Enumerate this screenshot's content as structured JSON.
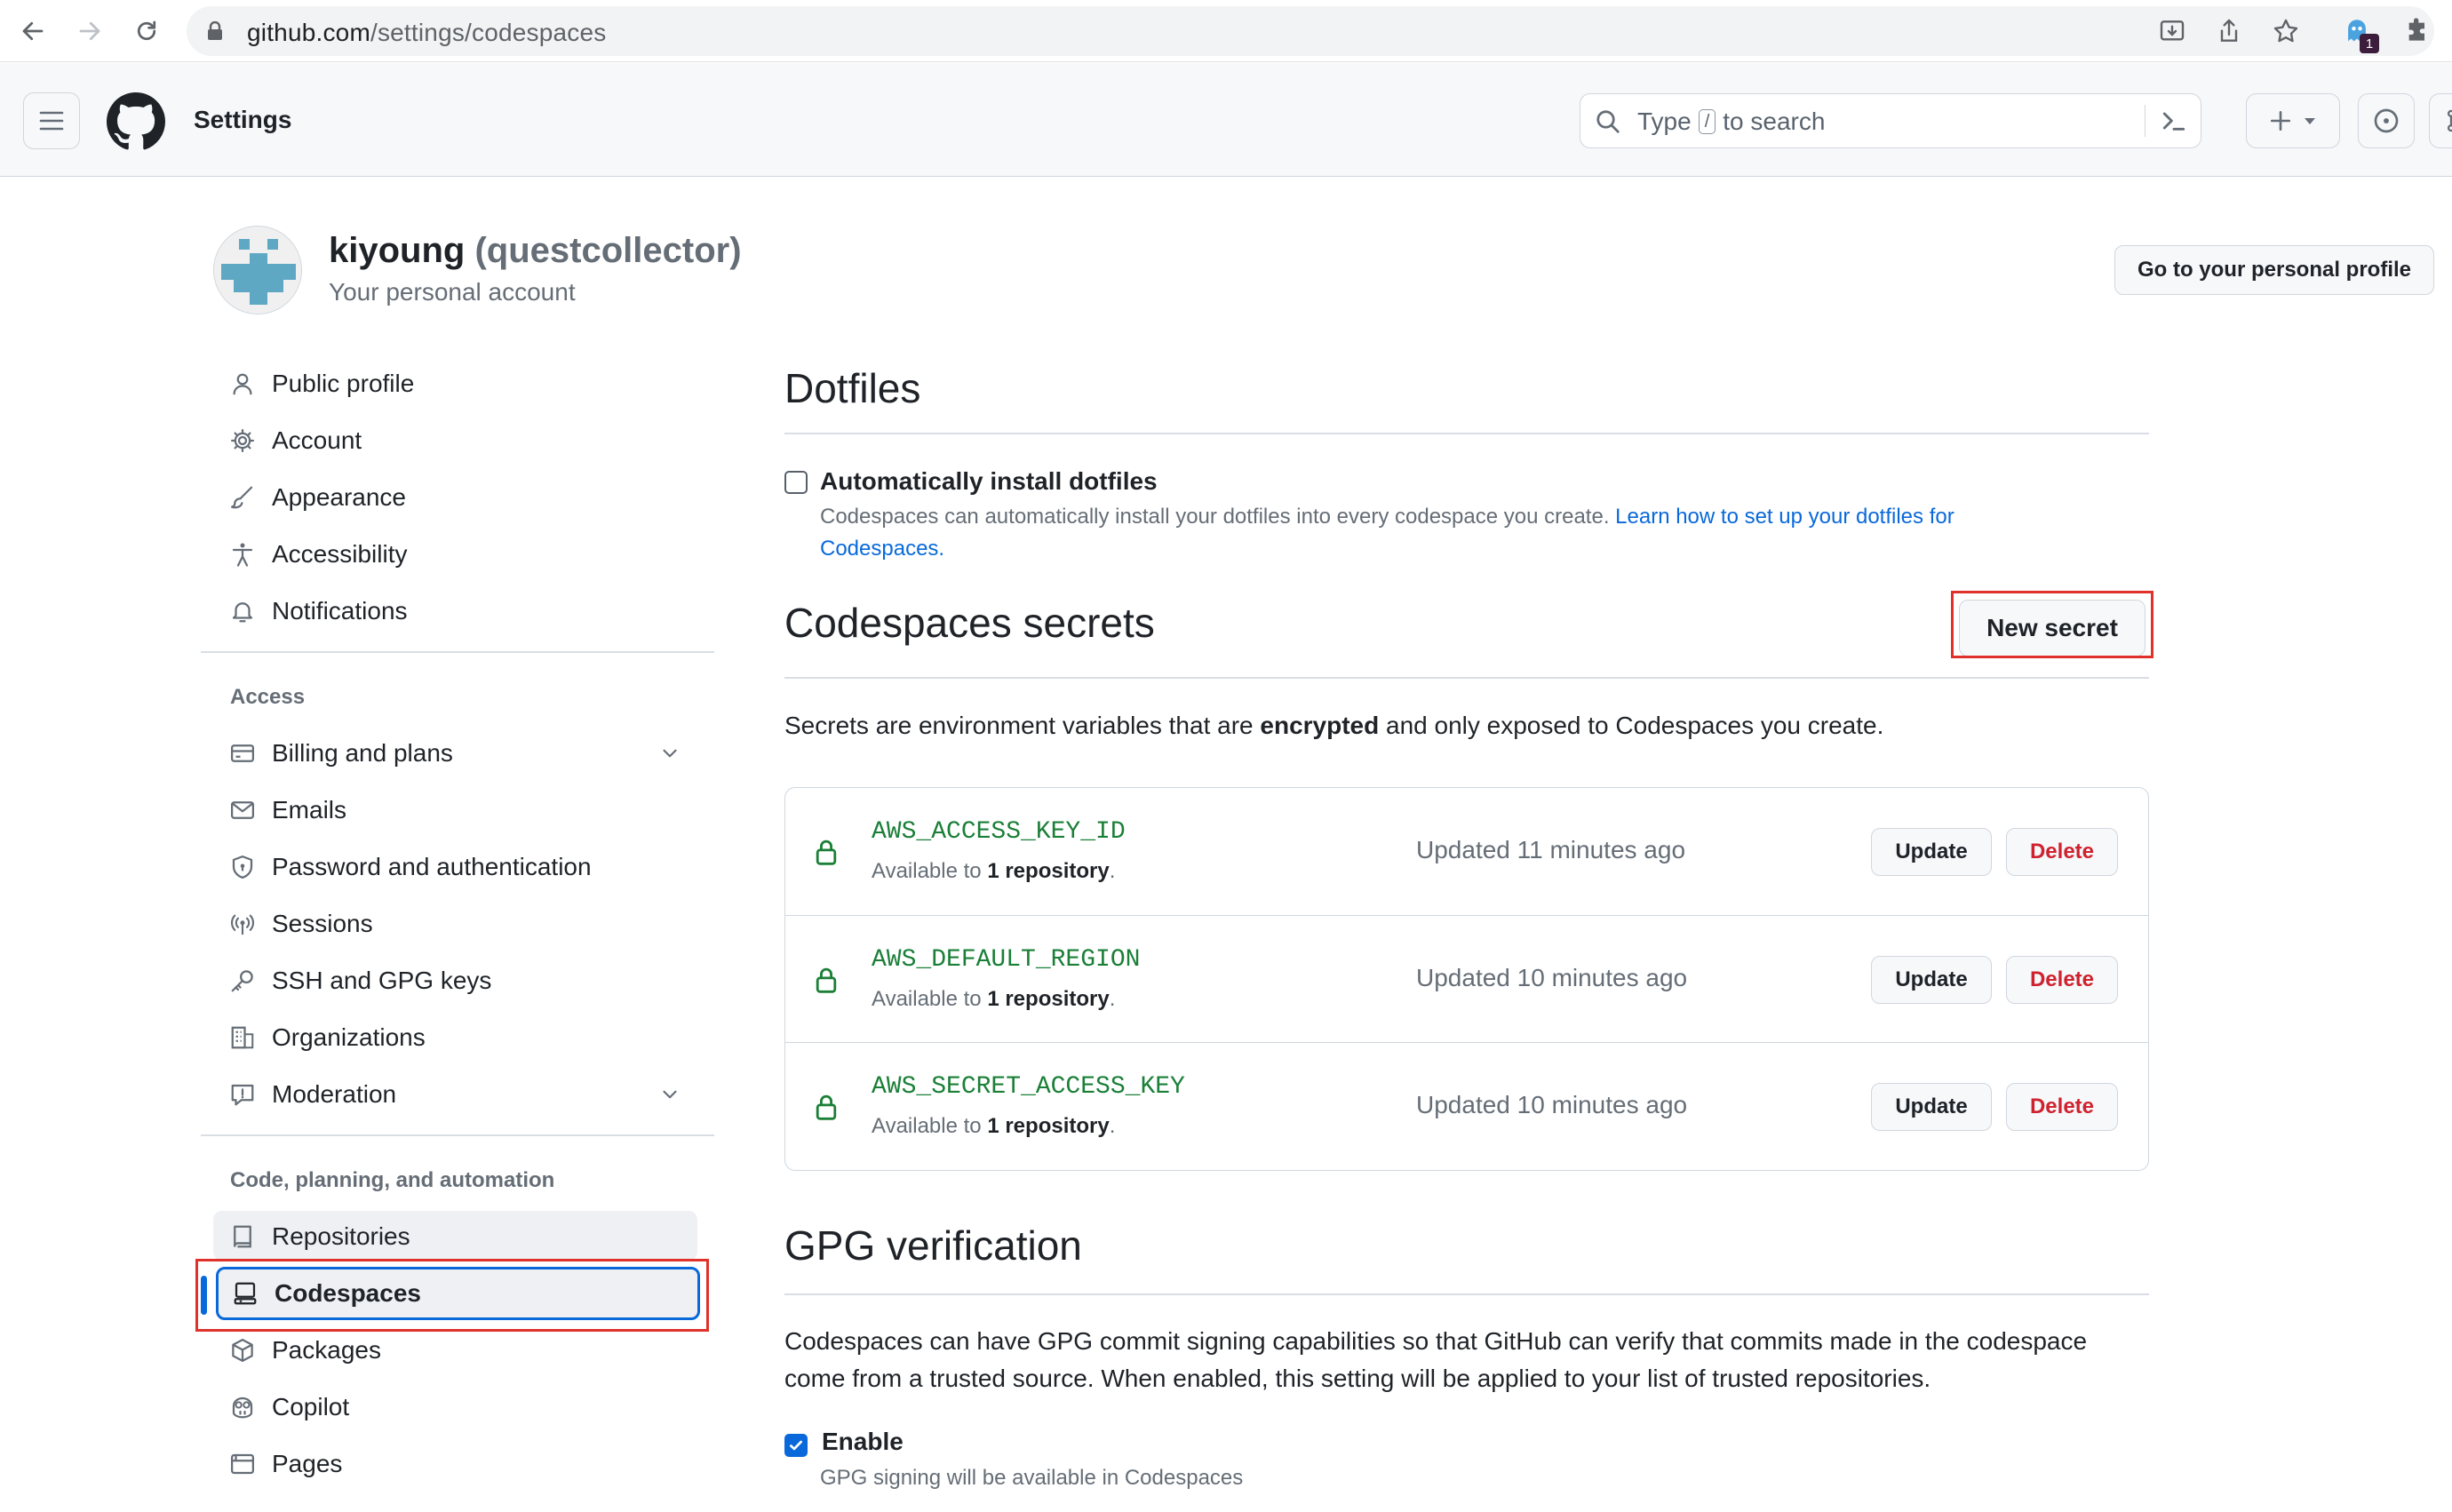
{
  "browser": {
    "url_host": "github.com",
    "url_path": "/settings/codespaces",
    "extension_badge": "1"
  },
  "header": {
    "context_title": "Settings",
    "search_prefix": "Type",
    "search_key": "/",
    "search_suffix": "to search"
  },
  "profile": {
    "name": "kiyoung",
    "login": "(questcollector)",
    "subtitle": "Your personal account",
    "go_profile_button": "Go to your personal profile"
  },
  "sidebar": {
    "top_items": [
      {
        "label": "Public profile",
        "icon": "person-icon"
      },
      {
        "label": "Account",
        "icon": "gear-icon"
      },
      {
        "label": "Appearance",
        "icon": "paintbrush-icon"
      },
      {
        "label": "Accessibility",
        "icon": "accessibility-icon"
      },
      {
        "label": "Notifications",
        "icon": "bell-icon"
      }
    ],
    "access_heading": "Access",
    "access_items": [
      {
        "label": "Billing and plans",
        "icon": "credit-card-icon"
      },
      {
        "label": "Emails",
        "icon": "mail-icon"
      },
      {
        "label": "Password and authentication",
        "icon": "shield-lock-icon"
      },
      {
        "label": "Sessions",
        "icon": "broadcast-icon"
      },
      {
        "label": "SSH and GPG keys",
        "icon": "key-icon"
      },
      {
        "label": "Organizations",
        "icon": "organization-icon"
      },
      {
        "label": "Moderation",
        "icon": "report-icon"
      }
    ],
    "code_heading": "Code, planning, and automation",
    "code_items": [
      {
        "label": "Repositories",
        "icon": "repo-icon"
      },
      {
        "label": "Codespaces",
        "icon": "codespaces-icon"
      },
      {
        "label": "Packages",
        "icon": "package-icon"
      },
      {
        "label": "Copilot",
        "icon": "copilot-icon"
      },
      {
        "label": "Pages",
        "icon": "browser-icon"
      }
    ]
  },
  "dotfiles": {
    "title": "Dotfiles",
    "checkbox_label": "Automatically install dotfiles",
    "checked": false,
    "help_text": "Codespaces can automatically install your dotfiles into every codespace you create.",
    "help_link_line1": "Learn how to set up your dotfiles for",
    "help_link_line2": "Codespaces."
  },
  "secrets": {
    "title": "Codespaces secrets",
    "new_button": "New secret",
    "description_pre": "Secrets are environment variables that are",
    "description_bold": "encrypted",
    "description_post": "and only exposed to Codespaces you create.",
    "available_prefix": "Available to",
    "available_count": "1 repository",
    "available_suffix": ".",
    "update_label": "Update",
    "delete_label": "Delete",
    "items": [
      {
        "name": "AWS_ACCESS_KEY_ID",
        "updated": "Updated 11 minutes ago"
      },
      {
        "name": "AWS_DEFAULT_REGION",
        "updated": "Updated 10 minutes ago"
      },
      {
        "name": "AWS_SECRET_ACCESS_KEY",
        "updated": "Updated 10 minutes ago"
      }
    ]
  },
  "gpg": {
    "title": "GPG verification",
    "description_line1": "Codespaces can have GPG commit signing capabilities so that GitHub can verify that commits made in the codespace",
    "description_line2": "come from a trusted source. When enabled, this setting will be applied to your list of trusted repositories.",
    "checkbox_label": "Enable",
    "checked": true,
    "help_text": "GPG signing will be available in Codespaces"
  },
  "colors": {
    "accent": "#0969da",
    "secret_name": "#1a7f37",
    "danger": "#cf222e",
    "highlight_box": "#e0322b"
  }
}
